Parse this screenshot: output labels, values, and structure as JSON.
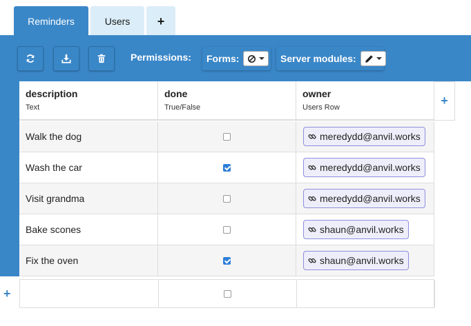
{
  "tabs": [
    {
      "label": "Reminders",
      "active": true
    },
    {
      "label": "Users",
      "active": false
    },
    {
      "label": "+",
      "active": false
    }
  ],
  "toolbar": {
    "buttons": [
      "refresh-icon",
      "download-icon",
      "trash-icon"
    ],
    "permissions_label": "Permissions:",
    "forms_label": "Forms:",
    "forms_value_icon": "no-access-icon",
    "server_modules_label": "Server modules:",
    "server_modules_value_icon": "pencil-icon"
  },
  "columns": [
    {
      "name": "description",
      "type": "Text"
    },
    {
      "name": "done",
      "type": "True/False"
    },
    {
      "name": "owner",
      "type": "Users Row"
    }
  ],
  "add_column_label": "+",
  "rows": [
    {
      "description": "Walk the dog",
      "done": false,
      "owner": "meredydd@anvil.works"
    },
    {
      "description": "Wash the car",
      "done": true,
      "owner": "meredydd@anvil.works"
    },
    {
      "description": "Visit grandma",
      "done": false,
      "owner": "meredydd@anvil.works"
    },
    {
      "description": "Bake scones",
      "done": false,
      "owner": "shaun@anvil.works"
    },
    {
      "description": "Fix the oven",
      "done": true,
      "owner": "shaun@anvil.works"
    }
  ],
  "new_row": {
    "description": "",
    "done": false,
    "owner": ""
  },
  "add_row_label": "+",
  "colors": {
    "accent": "#3a87c8",
    "tab_inactive": "#dbedf8",
    "link_border": "#8e8ede",
    "checkbox": "#2f7fd8"
  }
}
